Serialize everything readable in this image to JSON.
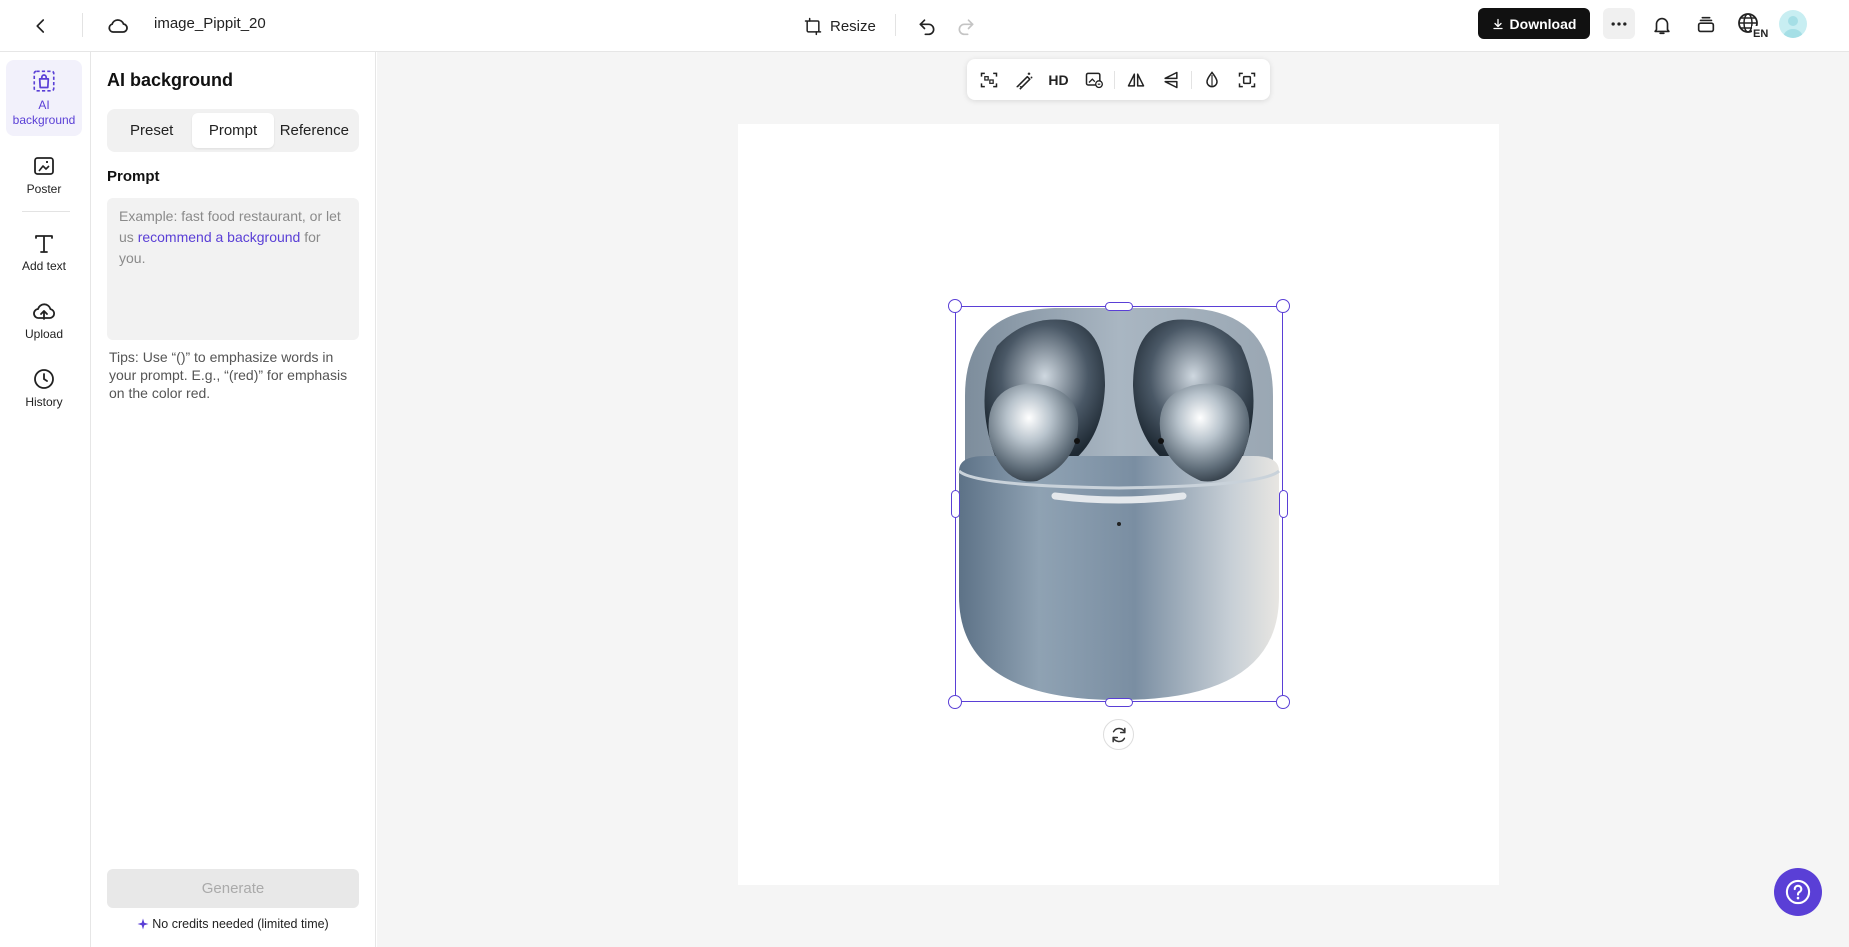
{
  "topbar": {
    "title": "image_Pippit_20",
    "resize_label": "Resize",
    "download_label": "Download",
    "language": "EN"
  },
  "rail": {
    "items": [
      {
        "label": "AI background",
        "icon": "bag-icon"
      },
      {
        "label": "Poster",
        "icon": "poster-icon"
      },
      {
        "label": "Add text",
        "icon": "text-icon"
      },
      {
        "label": "Upload",
        "icon": "cloud-upload-icon"
      },
      {
        "label": "History",
        "icon": "clock-icon"
      }
    ]
  },
  "panel": {
    "title": "AI background",
    "tabs": [
      "Preset",
      "Prompt",
      "Reference"
    ],
    "active_tab": "Prompt",
    "prompt_label": "Prompt",
    "placeholder_start": "Example: fast food restaurant, or let us ",
    "placeholder_link": "recommend a background",
    "placeholder_end": " for you.",
    "tips": "Tips: Use “()” to emphasize words in your prompt. E.g., “(red)” for emphasis on the color red.",
    "generate_label": "Generate",
    "credits_note": "No credits needed (limited time)"
  },
  "canvas": {
    "toolbar_hd_label": "HD"
  },
  "colors": {
    "accent": "#5a3fd6",
    "download_bg": "#111111",
    "canvas_bg": "#f5f5f5"
  }
}
